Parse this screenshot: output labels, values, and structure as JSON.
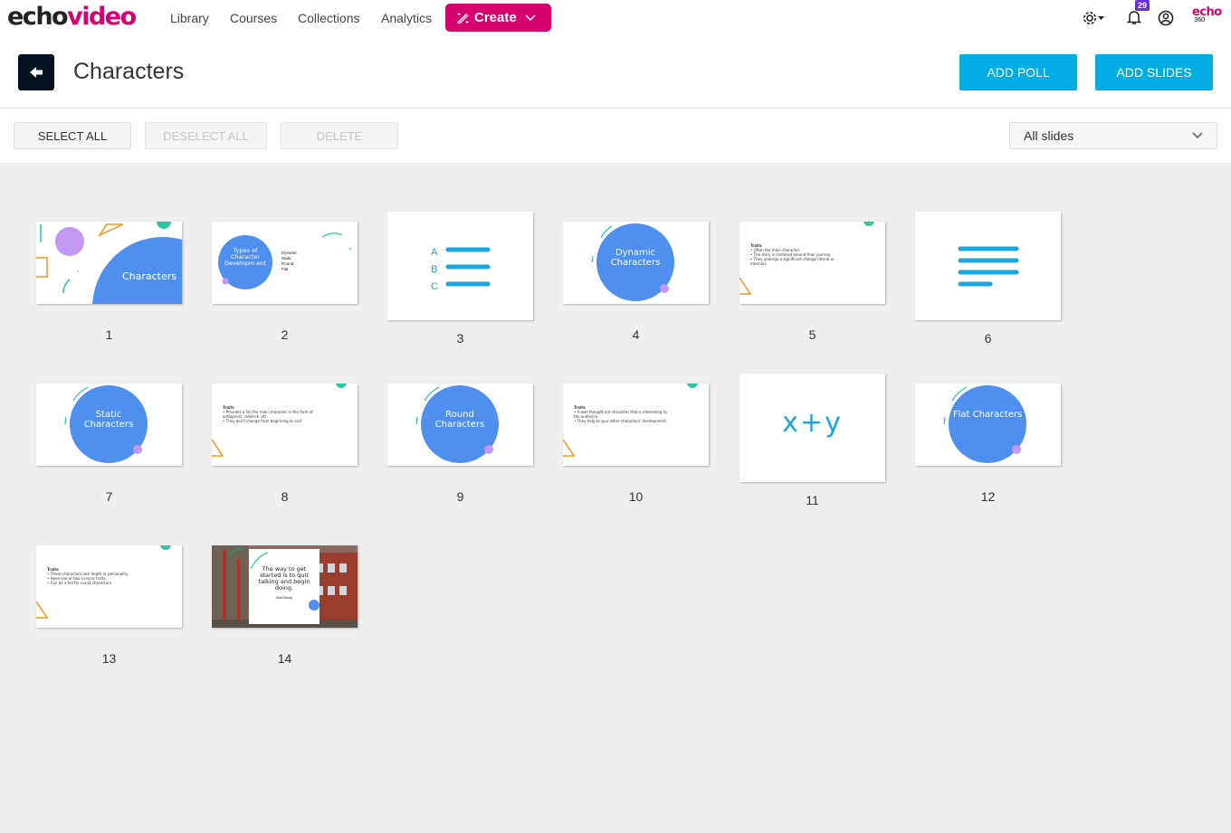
{
  "brand": {
    "logo_part1": "echo",
    "logo_part2": "video",
    "accent": "#d6006f",
    "corner_logo_top": "echo",
    "corner_logo_bottom": "360"
  },
  "nav": {
    "links": [
      "Library",
      "Courses",
      "Collections",
      "Analytics"
    ],
    "create_label": "Create",
    "notification_count": "29"
  },
  "header": {
    "title": "Characters",
    "add_poll_label": "ADD POLL",
    "add_slides_label": "ADD SLIDES",
    "primary_color": "#00ade2"
  },
  "toolbar": {
    "select_all": "SELECT ALL",
    "deselect_all": "DESELECT ALL",
    "delete": "DELETE",
    "filter_value": "All slides"
  },
  "slides": [
    {
      "number": "1",
      "type": "title",
      "title": "Characters"
    },
    {
      "number": "2",
      "type": "list",
      "circle_text": "Types of Character Developm ent",
      "items": [
        "Dynamic",
        "Static",
        "Round",
        "Flat"
      ]
    },
    {
      "number": "3",
      "type": "poll-multiple-choice",
      "options": [
        "A",
        "B",
        "C"
      ]
    },
    {
      "number": "4",
      "type": "section",
      "title": "Dynamic Characters"
    },
    {
      "number": "5",
      "type": "traits",
      "heading": "Traits",
      "bullets": [
        "Often the main character.",
        "The story is centered around their journey.",
        "They undergo a significant change (literal or internal)."
      ]
    },
    {
      "number": "6",
      "type": "poll-short-answer"
    },
    {
      "number": "7",
      "type": "section",
      "title": "Static Characters"
    },
    {
      "number": "8",
      "type": "traits",
      "heading": "Traits",
      "bullets": [
        "Provides a foil the main character in the form of antagonist, sidekick, etc.",
        "They don't change from beginning to end."
      ]
    },
    {
      "number": "9",
      "type": "section",
      "title": "Round Characters"
    },
    {
      "number": "10",
      "type": "traits",
      "heading": "Traits",
      "bullets": [
        "A well thought out character that is interesting to the audience.",
        "They help to spur other characters' development."
      ]
    },
    {
      "number": "11",
      "type": "poll-numeric",
      "label": "x+y"
    },
    {
      "number": "12",
      "type": "section",
      "title": "Flat Characters"
    },
    {
      "number": "13",
      "type": "traits",
      "heading": "Traits",
      "bullets": [
        "These characters lack depth or personality.",
        "Have one or two cursory traits.",
        "Can be a foil for round characters."
      ]
    },
    {
      "number": "14",
      "type": "quote",
      "quote": "The way to get started is to quit talking and begin doing.",
      "author": "Walt Disney"
    }
  ]
}
